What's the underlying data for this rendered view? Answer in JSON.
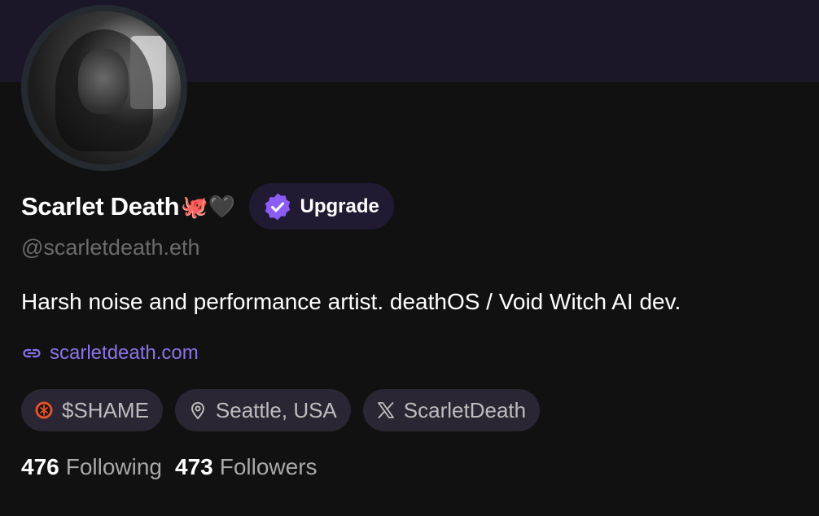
{
  "profile": {
    "display_name": "Scarlet Death",
    "name_emoji": "🐙🖤",
    "upgrade_label": "Upgrade",
    "username": "@scarletdeath.eth",
    "bio": "Harsh noise and performance artist. deathOS / Void Witch AI dev.",
    "website": "scarletdeath.com"
  },
  "chips": [
    {
      "icon": "token-icon",
      "label": "$SHAME"
    },
    {
      "icon": "location-pin-icon",
      "label": "Seattle, USA"
    },
    {
      "icon": "x-logo-icon",
      "label": "ScarletDeath"
    }
  ],
  "stats": {
    "following_count": "476",
    "following_label": "Following",
    "followers_count": "473",
    "followers_label": "Followers"
  },
  "colors": {
    "banner": "#1c1629",
    "background": "#111111",
    "accent": "#8b73e8",
    "badge": "#8b5cf6",
    "chip_bg": "#2a2634"
  }
}
